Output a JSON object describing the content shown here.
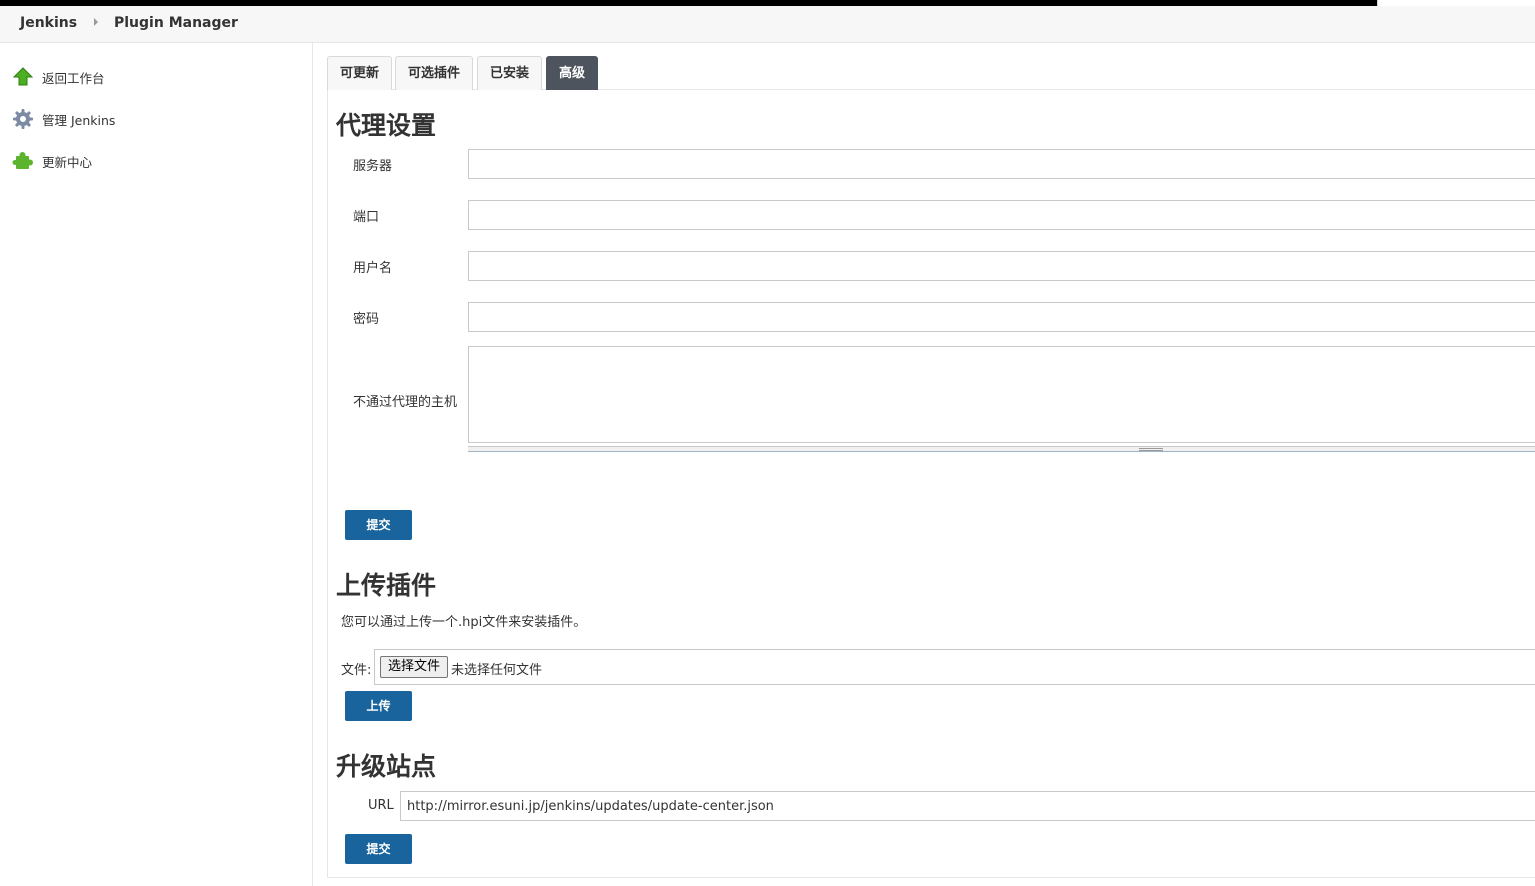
{
  "breadcrumb": {
    "root": "Jenkins",
    "current": "Plugin Manager"
  },
  "sidebar": {
    "items": [
      {
        "label": "返回工作台",
        "icon": "up-arrow-icon"
      },
      {
        "label": "管理 Jenkins",
        "icon": "gear-icon"
      },
      {
        "label": "更新中心",
        "icon": "puzzle-icon"
      }
    ]
  },
  "tabs": [
    {
      "label": "可更新",
      "active": false
    },
    {
      "label": "可选插件",
      "active": false
    },
    {
      "label": "已安装",
      "active": false
    },
    {
      "label": "高级",
      "active": true
    }
  ],
  "proxy": {
    "title": "代理设置",
    "server_label": "服务器",
    "server_value": "",
    "port_label": "端口",
    "port_value": "",
    "username_label": "用户名",
    "username_value": "",
    "password_label": "密码",
    "password_value": "",
    "no_proxy_label": "不通过代理的主机",
    "no_proxy_value": "",
    "submit_label": "提交"
  },
  "upload": {
    "title": "上传插件",
    "description": "您可以通过上传一个.hpi文件来安装插件。",
    "file_label": "文件:",
    "choose_label": "选择文件",
    "no_file_text": "未选择任何文件",
    "upload_label": "上传"
  },
  "update_site": {
    "title": "升级站点",
    "url_label": "URL",
    "url_value": "http://mirror.esuni.jp/jenkins/updates/update-center.json",
    "submit_label": "提交"
  },
  "colors": {
    "button": "#19649c",
    "active_tab": "#4d545d",
    "arrow_green": "#4caf22",
    "puzzle_green": "#5cb32e",
    "gear": "#7d8aa3"
  }
}
